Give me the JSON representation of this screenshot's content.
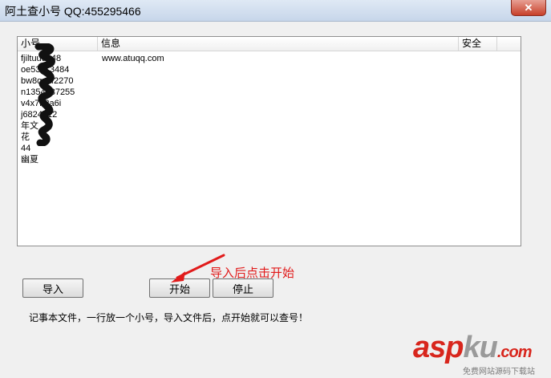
{
  "window": {
    "title": "阿土查小号 QQ:455295466",
    "close_label": "✕"
  },
  "list": {
    "columns": {
      "account": "小号",
      "info": "信息",
      "safety": "安全"
    },
    "rows": [
      {
        "account": "fjiltuu9348",
        "info": "www.atuqq.com"
      },
      {
        "account": "oe53113484",
        "info": ""
      },
      {
        "account": "bw8quxf2270",
        "info": ""
      },
      {
        "account": "n1354337255",
        "info": ""
      },
      {
        "account": "v4x7h2a6i",
        "info": ""
      },
      {
        "account": "j6824412",
        "info": ""
      },
      {
        "account": "年文",
        "info": ""
      },
      {
        "account": "花",
        "info": ""
      },
      {
        "account": "44",
        "info": ""
      },
      {
        "account": "幽夏",
        "info": ""
      }
    ]
  },
  "buttons": {
    "import": "导入",
    "start": "开始",
    "stop": "停止"
  },
  "annotation": "导入后点击开始",
  "hint": "记事本文件，一行放一个小号，导入文件后，点开始就可以查号！",
  "watermark": {
    "part1": "asp",
    "part2": "ku",
    "part3": ".com",
    "sub": "免费网站源码下载站"
  },
  "colors": {
    "annotation_red": "#e11b1b",
    "watermark_red": "#d8261d"
  }
}
